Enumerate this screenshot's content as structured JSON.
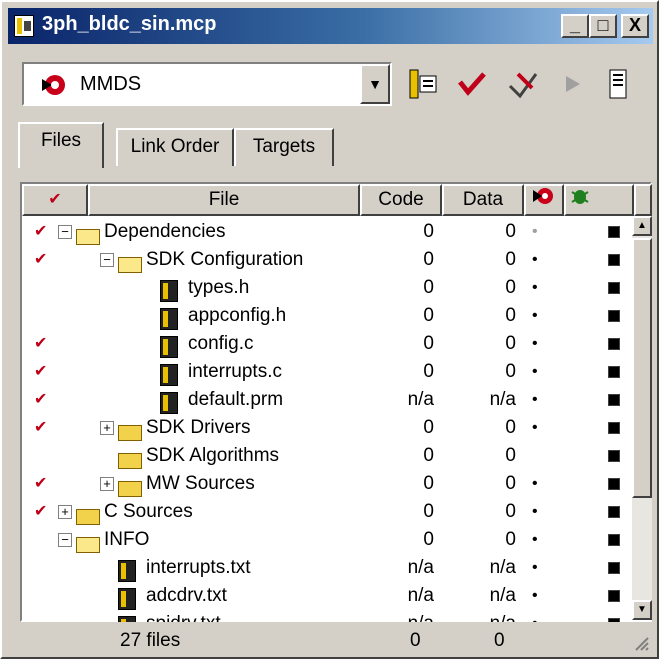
{
  "window": {
    "title": "3ph_bldc_sin.mcp"
  },
  "title_buttons": [
    "_",
    "□",
    "X"
  ],
  "toolbar": {
    "target": "MMDS",
    "tools": [
      "settings-icon",
      "make-icon",
      "debug-icon",
      "run-icon",
      "project-window-icon"
    ]
  },
  "tabs": [
    "Files",
    "Link Order",
    "Targets"
  ],
  "columns": {
    "check": "✔",
    "file": "File",
    "code": "Code",
    "data": "Data"
  },
  "rows": [
    {
      "checked": true,
      "indent": 0,
      "expand": "−",
      "icon": "folder-open",
      "name": "Dependencies",
      "code": "0",
      "data": "0",
      "dot": "•",
      "dot_grey": true
    },
    {
      "checked": true,
      "indent": 1,
      "expand": "−",
      "icon": "folder-open",
      "name": "SDK Configuration",
      "code": "0",
      "data": "0",
      "dot": "•"
    },
    {
      "checked": false,
      "indent": 2,
      "expand": "",
      "icon": "file",
      "name": "types.h",
      "code": "0",
      "data": "0",
      "dot": "•"
    },
    {
      "checked": false,
      "indent": 2,
      "expand": "",
      "icon": "file",
      "name": "appconfig.h",
      "code": "0",
      "data": "0",
      "dot": "•"
    },
    {
      "checked": true,
      "indent": 2,
      "expand": "",
      "icon": "file",
      "name": "config.c",
      "code": "0",
      "data": "0",
      "dot": "•"
    },
    {
      "checked": true,
      "indent": 2,
      "expand": "",
      "icon": "file",
      "name": "interrupts.c",
      "code": "0",
      "data": "0",
      "dot": "•"
    },
    {
      "checked": true,
      "indent": 2,
      "expand": "",
      "icon": "file",
      "name": "default.prm",
      "code": "n/a",
      "data": "n/a",
      "dot": "•"
    },
    {
      "checked": true,
      "indent": 1,
      "expand": "+",
      "icon": "folder",
      "name": "SDK Drivers",
      "code": "0",
      "data": "0",
      "dot": "•"
    },
    {
      "checked": false,
      "indent": 1,
      "expand": "",
      "icon": "folder",
      "name": "SDK Algorithms",
      "code": "0",
      "data": "0",
      "dot": ""
    },
    {
      "checked": true,
      "indent": 1,
      "expand": "+",
      "icon": "folder",
      "name": "MW Sources",
      "code": "0",
      "data": "0",
      "dot": "•"
    },
    {
      "checked": true,
      "indent": 0,
      "expand": "+",
      "icon": "folder",
      "name": "C Sources",
      "code": "0",
      "data": "0",
      "dot": "•"
    },
    {
      "checked": false,
      "indent": 0,
      "expand": "−",
      "icon": "folder-open",
      "name": "INFO",
      "code": "0",
      "data": "0",
      "dot": "•"
    },
    {
      "checked": false,
      "indent": 1,
      "expand": "",
      "icon": "file",
      "name": "interrupts.txt",
      "code": "n/a",
      "data": "n/a",
      "dot": "•"
    },
    {
      "checked": false,
      "indent": 1,
      "expand": "",
      "icon": "file",
      "name": "adcdrv.txt",
      "code": "n/a",
      "data": "n/a",
      "dot": "•"
    },
    {
      "checked": false,
      "indent": 1,
      "expand": "",
      "icon": "file",
      "name": "spidrv.txt",
      "code": "n/a",
      "data": "n/a",
      "dot": "•"
    }
  ],
  "status": {
    "files": "27 files",
    "code": "0",
    "data": "0"
  }
}
